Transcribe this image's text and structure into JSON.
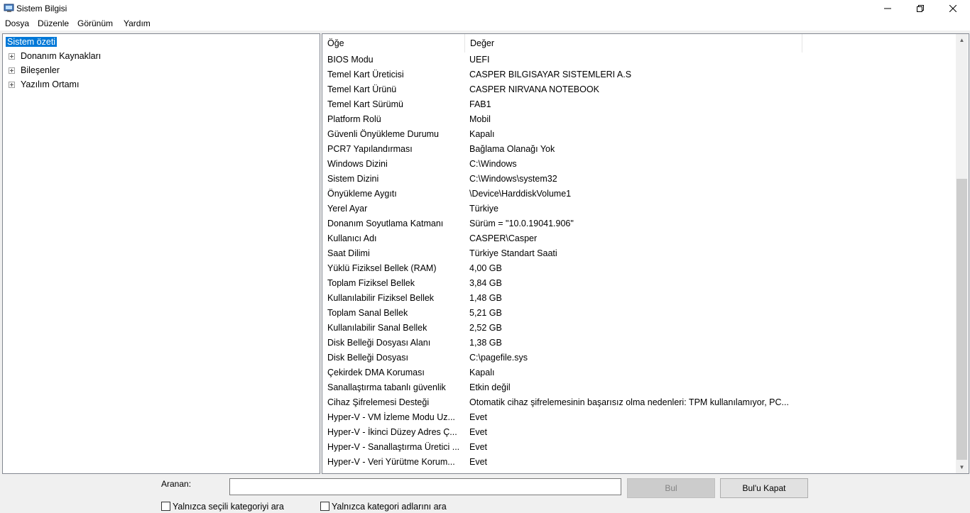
{
  "window": {
    "title": "Sistem Bilgisi"
  },
  "menu": [
    "Dosya",
    "Düzenle",
    "Görünüm",
    "Yardım"
  ],
  "tree": {
    "selected": "Sistem özeti",
    "children": [
      "Donanım Kaynakları",
      "Bileşenler",
      "Yazılım Ortamı"
    ]
  },
  "table": {
    "columns": [
      "Öğe",
      "Değer"
    ],
    "rows": [
      [
        "BIOS Modu",
        "UEFI"
      ],
      [
        "Temel Kart Üreticisi",
        "CASPER BILGISAYAR SISTEMLERI A.S"
      ],
      [
        "Temel Kart Ürünü",
        "CASPER NIRVANA NOTEBOOK"
      ],
      [
        "Temel Kart Sürümü",
        "FAB1"
      ],
      [
        "Platform Rolü",
        "Mobil"
      ],
      [
        "Güvenli Önyükleme Durumu",
        "Kapalı"
      ],
      [
        "PCR7 Yapılandırması",
        "Bağlama Olanağı Yok"
      ],
      [
        "Windows Dizini",
        "C:\\Windows"
      ],
      [
        "Sistem Dizini",
        "C:\\Windows\\system32"
      ],
      [
        "Önyükleme Aygıtı",
        "\\Device\\HarddiskVolume1"
      ],
      [
        "Yerel Ayar",
        "Türkiye"
      ],
      [
        "Donanım Soyutlama Katmanı",
        "Sürüm = \"10.0.19041.906\""
      ],
      [
        "Kullanıcı Adı",
        "CASPER\\Casper"
      ],
      [
        "Saat Dilimi",
        "Türkiye Standart Saati"
      ],
      [
        "Yüklü Fiziksel Bellek (RAM)",
        "4,00 GB"
      ],
      [
        "Toplam Fiziksel Bellek",
        "3,84 GB"
      ],
      [
        "Kullanılabilir Fiziksel Bellek",
        "1,48 GB"
      ],
      [
        "Toplam Sanal Bellek",
        "5,21 GB"
      ],
      [
        "Kullanılabilir Sanal Bellek",
        "2,52 GB"
      ],
      [
        "Disk Belleği Dosyası Alanı",
        "1,38 GB"
      ],
      [
        "Disk Belleği Dosyası",
        "C:\\pagefile.sys"
      ],
      [
        "Çekirdek DMA Koruması",
        "Kapalı"
      ],
      [
        "Sanallaştırma tabanlı güvenlik",
        "Etkin değil"
      ],
      [
        "Cihaz Şifrelemesi Desteği",
        "Otomatik cihaz şifrelemesinin başarısız olma nedenleri: TPM kullanılamıyor, PC..."
      ],
      [
        "Hyper-V - VM İzleme Modu Uz...",
        "Evet"
      ],
      [
        "Hyper-V - İkinci Düzey Adres Ç...",
        "Evet"
      ],
      [
        "Hyper-V - Sanallaştırma Üretici ...",
        "Evet"
      ],
      [
        "Hyper-V - Veri Yürütme Korum...",
        "Evet"
      ]
    ]
  },
  "search": {
    "label": "Aranan:",
    "value": "",
    "find_button": "Bul",
    "close_button": "Bul'u Kapat",
    "option1": "Yalnızca seçili kategoriyi ara",
    "option2": "Yalnızca kategori adlarını ara"
  }
}
